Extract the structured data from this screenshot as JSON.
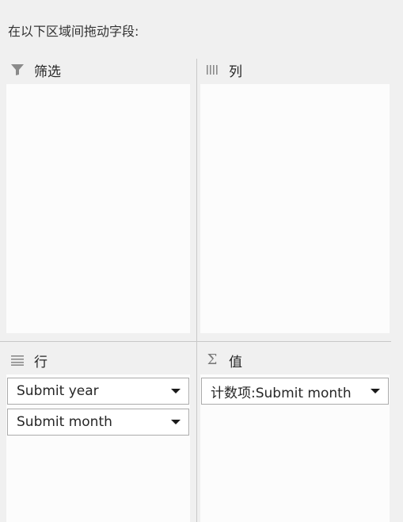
{
  "instruction": "在以下区域间拖动字段:",
  "areas": {
    "filters": {
      "label": "筛选",
      "icon": "filter-icon",
      "fields": []
    },
    "columns": {
      "label": "列",
      "icon": "columns-icon",
      "fields": []
    },
    "rows": {
      "label": "行",
      "icon": "rows-icon",
      "fields": [
        {
          "label": "Submit year"
        },
        {
          "label": "Submit month"
        }
      ]
    },
    "values": {
      "label": "值",
      "icon": "sigma-icon",
      "fields": [
        {
          "label": "计数项:Submit month"
        }
      ]
    }
  },
  "colors": {
    "pane_background": "#f0f0f0",
    "drop_zone": "#fcfcfc",
    "chip_border": "#ababab",
    "icon_gray": "#7a7a7a"
  }
}
